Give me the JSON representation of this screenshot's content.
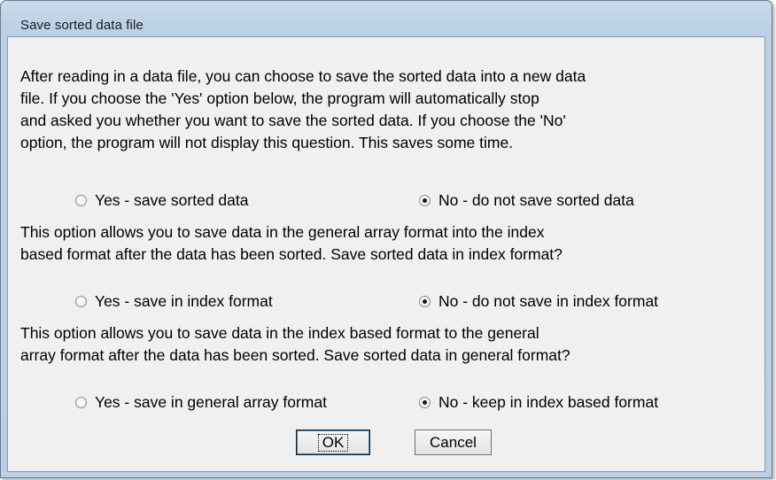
{
  "window": {
    "title": "Save sorted data file"
  },
  "sections": [
    {
      "text": "After reading in a data file, you can choose to save the sorted data into a new data\nfile. If you choose the 'Yes' option below, the program will automatically stop\nand asked you whether you want to save the sorted data. If you choose the 'No'\noption, the program will not display this question. This saves some time.",
      "yes_label": "Yes - save sorted data",
      "no_label": "No - do not save sorted data",
      "selected": "no"
    },
    {
      "text": "This option allows you to save data in the general array format into the index\nbased format after the data has been sorted. Save sorted data in index format?",
      "yes_label": "Yes - save in index format",
      "no_label": "No - do not save in index format",
      "selected": "no"
    },
    {
      "text": "This option allows you to save data in the index based format to the general\narray format after the data has been sorted. Save sorted data in general format?",
      "yes_label": "Yes - save in general array format",
      "no_label": "No - keep in index based format",
      "selected": "no"
    }
  ],
  "buttons": {
    "ok_label": "OK",
    "cancel_label": "Cancel"
  }
}
